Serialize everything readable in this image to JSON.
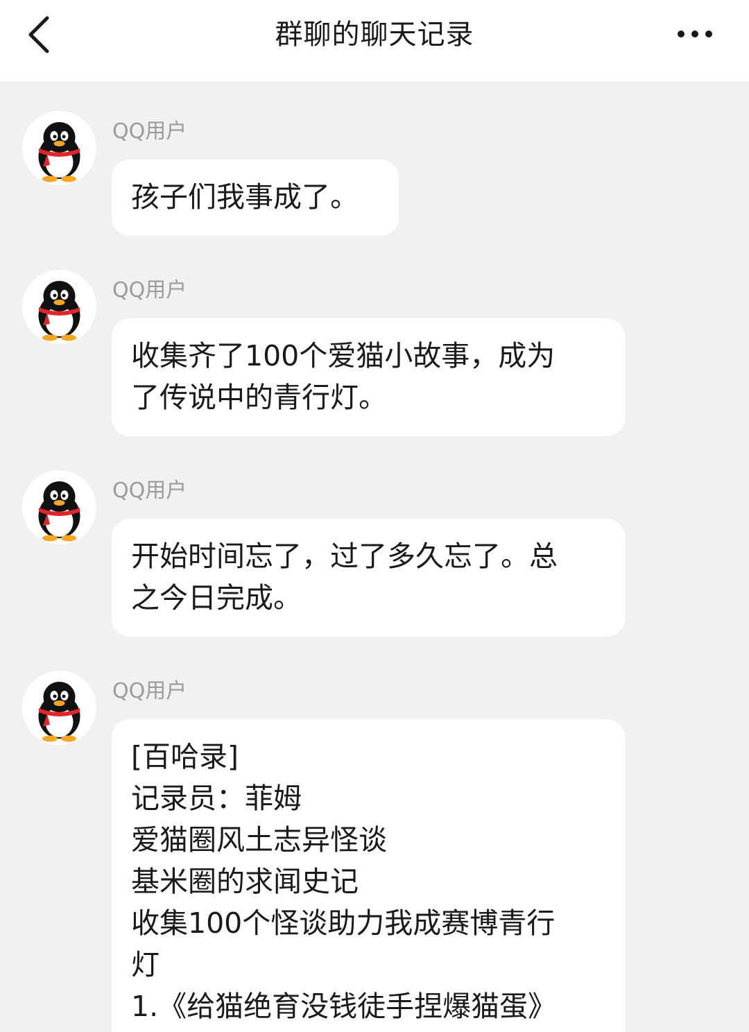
{
  "header": {
    "title": "群聊的聊天记录",
    "back_icon": "chevron-left-icon",
    "more_icon": "more-horizontal-icon"
  },
  "messages": [
    {
      "sender": "QQ用户",
      "lines": [
        "孩子们我事成了。"
      ]
    },
    {
      "sender": "QQ用户",
      "lines": [
        "收集齐了100个爱猫小故事，成为",
        "了传说中的青行灯。"
      ]
    },
    {
      "sender": "QQ用户",
      "lines": [
        "开始时间忘了，过了多久忘了。总",
        "之今日完成。"
      ]
    },
    {
      "sender": "QQ用户",
      "lines": [
        "[百哈录]",
        "记录员：菲姆",
        "爱猫圈风土志异怪谈",
        "基米圈的求闻史记",
        "收集100个怪谈助力我成赛博青行",
        "灯",
        "1.《给猫绝育没钱徒手捏爆猫蛋》"
      ]
    }
  ],
  "colors": {
    "background": "#f1f1f1",
    "header_bg": "#ffffff",
    "bubble_bg": "#ffffff",
    "sender_text": "#9b9b9b",
    "message_text": "#1a1a1a",
    "avatar_scarf": "#e0262b",
    "avatar_feet": "#f5a623"
  }
}
